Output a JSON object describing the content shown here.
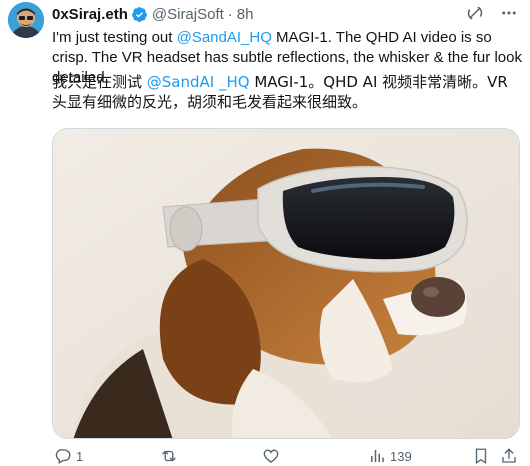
{
  "author": {
    "display_name": "0xSiraj.eth",
    "handle": "@SirajSoft",
    "separator": "·",
    "time": "8h"
  },
  "tweet": {
    "en_before": "I'm just testing out ",
    "en_mention": "@SandAI_HQ",
    "en_after": "  MAGI-1. The QHD AI video is so crisp. The VR headset has subtle reflections, the whisker & the fur look detailed.",
    "zh_before": "我只是在测试 ",
    "zh_mention": "@SandAI _HQ",
    "zh_after": "  MAGI-1。QHD AI 视频非常清晰。VR 头显有细微的反光，胡须和毛发看起来很细致。"
  },
  "actions": {
    "replies": "1",
    "reposts": "",
    "likes": "",
    "views": "139"
  },
  "icons": {
    "verified": "verified-badge-icon",
    "grok": "grok-icon",
    "more": "more-icon",
    "reply": "reply-icon",
    "repost": "repost-icon",
    "like": "heart-icon",
    "views": "analytics-icon",
    "bookmark": "bookmark-icon",
    "share": "share-icon"
  },
  "colors": {
    "accent": "#1d9bf0",
    "text": "#0f1419",
    "secondary": "#536471"
  }
}
